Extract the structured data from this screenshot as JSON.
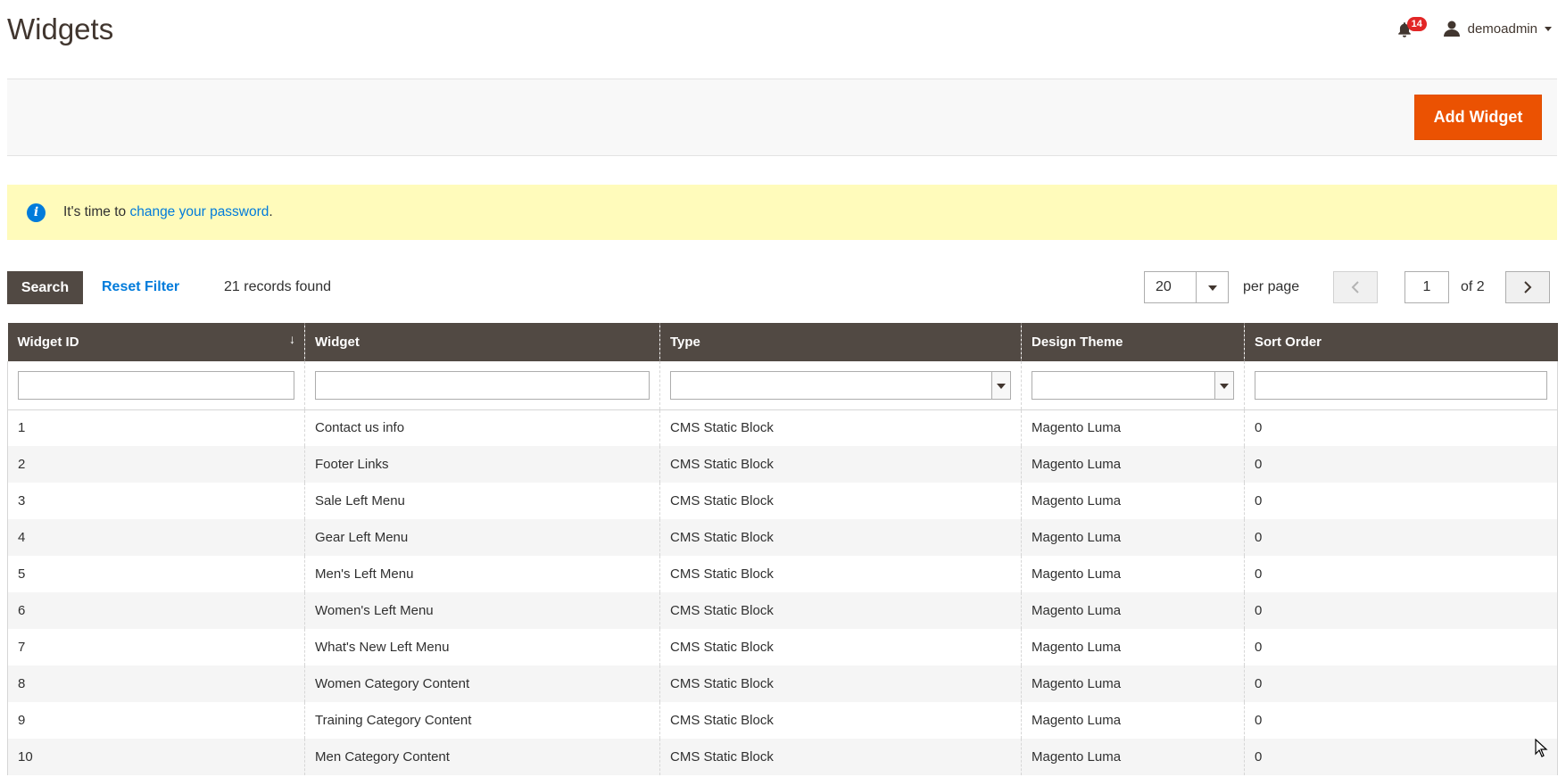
{
  "page": {
    "title": "Widgets"
  },
  "header": {
    "notification_count": "14",
    "username": "demoadmin"
  },
  "actions": {
    "add_label": "Add Widget"
  },
  "message": {
    "prefix": "It's time to ",
    "link_text": "change your password",
    "suffix": "."
  },
  "toolbar": {
    "search_label": "Search",
    "reset_label": "Reset Filter",
    "records_found": "21 records found",
    "per_page_value": "20",
    "per_page_label": "per page",
    "page_current": "1",
    "page_total": "of 2"
  },
  "grid": {
    "columns": [
      "Widget ID",
      "Widget",
      "Type",
      "Design Theme",
      "Sort Order"
    ],
    "rows": [
      {
        "id": "1",
        "widget": "Contact us info",
        "type": "CMS Static Block",
        "theme": "Magento Luma",
        "sort": "0"
      },
      {
        "id": "2",
        "widget": "Footer Links",
        "type": "CMS Static Block",
        "theme": "Magento Luma",
        "sort": "0"
      },
      {
        "id": "3",
        "widget": "Sale Left Menu",
        "type": "CMS Static Block",
        "theme": "Magento Luma",
        "sort": "0"
      },
      {
        "id": "4",
        "widget": "Gear Left Menu",
        "type": "CMS Static Block",
        "theme": "Magento Luma",
        "sort": "0"
      },
      {
        "id": "5",
        "widget": "Men's Left Menu",
        "type": "CMS Static Block",
        "theme": "Magento Luma",
        "sort": "0"
      },
      {
        "id": "6",
        "widget": "Women's Left Menu",
        "type": "CMS Static Block",
        "theme": "Magento Luma",
        "sort": "0"
      },
      {
        "id": "7",
        "widget": "What's New Left Menu",
        "type": "CMS Static Block",
        "theme": "Magento Luma",
        "sort": "0"
      },
      {
        "id": "8",
        "widget": "Women Category Content",
        "type": "CMS Static Block",
        "theme": "Magento Luma",
        "sort": "0"
      },
      {
        "id": "9",
        "widget": "Training Category Content",
        "type": "CMS Static Block",
        "theme": "Magento Luma",
        "sort": "0"
      },
      {
        "id": "10",
        "widget": "Men Category Content",
        "type": "CMS Static Block",
        "theme": "Magento Luma",
        "sort": "0"
      }
    ]
  },
  "colors": {
    "accent": "#eb5202",
    "header_bg": "#514943",
    "link": "#007bdb",
    "message_bg": "#fffbbb",
    "badge": "#e22626"
  },
  "icons": [
    "bell-icon",
    "user-icon",
    "chevron-down-icon",
    "info-icon",
    "chevron-left-icon",
    "chevron-right-icon",
    "sort-down-icon",
    "mouse-cursor-icon"
  ]
}
